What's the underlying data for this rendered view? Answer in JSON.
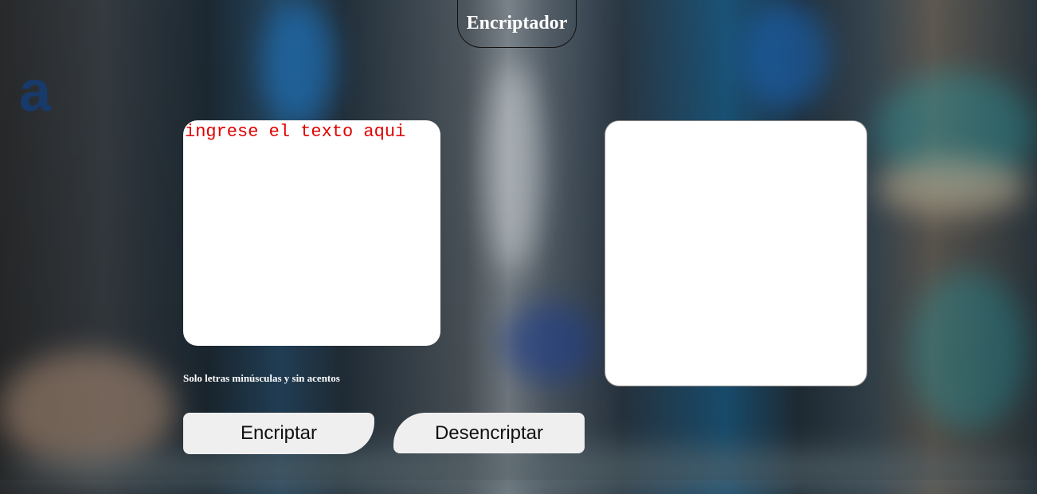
{
  "header": {
    "title": "Encriptador"
  },
  "logo": {
    "glyph": "a",
    "color": "#173a6b"
  },
  "input": {
    "placeholder": "ingrese el texto aqui",
    "value": ""
  },
  "output": {
    "value": ""
  },
  "hint": {
    "text": "Solo letras minúsculas y sin acentos"
  },
  "buttons": {
    "encrypt_label": "Encriptar",
    "decrypt_label": "Desencriptar"
  },
  "colors": {
    "placeholder": "#e00000",
    "panel": "#ffffff",
    "button": "#efefef"
  }
}
